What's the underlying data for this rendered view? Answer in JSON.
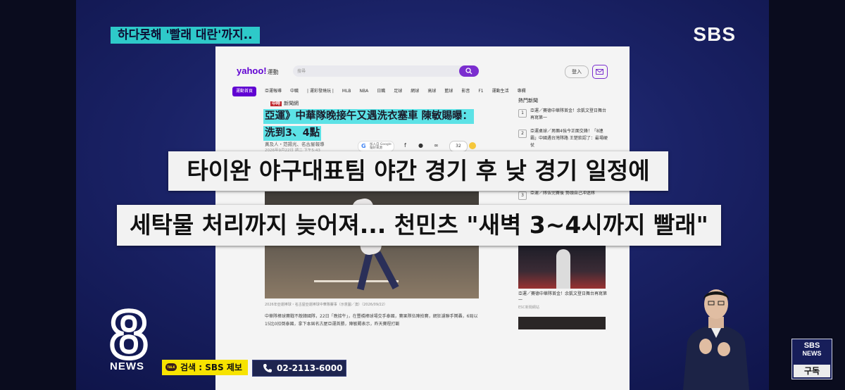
{
  "top_caption": "하다못해 '빨래 대란'까지..",
  "broadcaster_logo": "SBS",
  "webpage": {
    "logo_main": "yahoo!",
    "logo_sub": "運動",
    "search_placeholder": "搜尋",
    "login_label": "登入",
    "nav": [
      "運動首頁",
      "亞運報導",
      "中職",
      "| 運彩發燒玩 |",
      "MLB",
      "NBA",
      "日職",
      "足球",
      "網球",
      "高球",
      "籃球",
      "影音",
      "F1",
      "運動生活",
      "專欄"
    ],
    "source_tag": "中時",
    "source_name": "新聞網",
    "title_line1": "亞運》中華隊晚接午又遇洗衣塞車 陳敏賜曝：",
    "title_line2": "洗到3、4點",
    "byline": "黃及人・范揚光、名古屋報導",
    "date": "2026年9月22日 週二 下午5:43",
    "google_pill_line1": "加入自 Google",
    "google_pill_line2": "偏好來源",
    "share_icons": [
      "facebook-icon",
      "line-icon",
      "link-icon"
    ],
    "comment_count": "32",
    "hot_news_title": "熱門新聞",
    "hot_news": [
      {
        "num": "1",
        "text": "亞運／賽德中華隊首金！余凱文登日舞台再寫第一"
      },
      {
        "num": "2",
        "text": "亞運桌球／男團4強今正面交鋒！「8連霸」中國遇台灣隊路 王楚欽認了：最場硬仗"
      },
      {
        "num": "3",
        "text": "亞運／隊伍完賽後 勢頭自己冲迷隊"
      }
    ],
    "photo_caption": "2026年亞運棒球・名古屋亞運棒球中華隊賽事（示意圖／澳）（2026/09/22）",
    "body_text": "中華隊棒球賽戰不敵韓國隊，22日「晚接午」，在豐橋棒球場交手泰國，賽果隊伍陣拍賽，網狂濾聯手鬨轟，6局以15比0扣倒泰國，拿下本屆名古屋亞運首勝，陣敏賜表示，昨天賽程打斷",
    "side_caption": "亞運／賽德中華隊首金！余凱文登日舞台再寫第一",
    "side_source": "ESC新聞網站"
  },
  "subtitle_line1": "타이완 야구대표팀 야간 경기 후 낮 경기 일정에",
  "subtitle_line2": "세탁물 처리까지 늦어져... 천민츠 \"새벽 3~4시까지 빨래\"",
  "news_logo_number": "8",
  "news_logo_text": "NEWS",
  "kakao_badge": "TALK",
  "kakao_text": "검색 : SBS 제보",
  "phone_text": "02-2113-6000",
  "subscribe": {
    "line1": "SBS",
    "line2": "NEWS",
    "line3": "구독"
  },
  "colors": {
    "caption_bg": "#2ec9c9",
    "yahoo_purple": "#6001d2",
    "kakao_yellow": "#f7e300",
    "title_highlight": "#5ce2e6"
  }
}
